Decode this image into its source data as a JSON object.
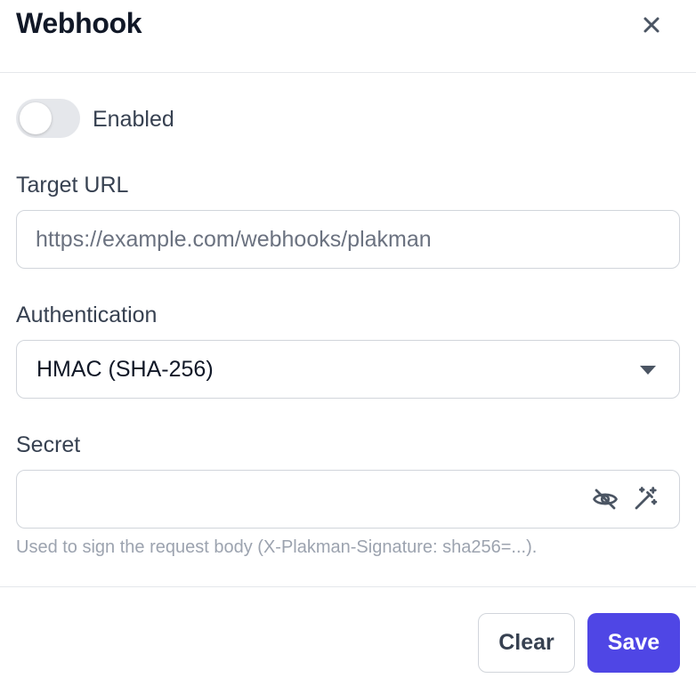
{
  "dialog": {
    "title": "Webhook"
  },
  "enabled": {
    "label": "Enabled",
    "value": false
  },
  "target_url": {
    "label": "Target URL",
    "placeholder": "https://example.com/webhooks/plakman",
    "value": ""
  },
  "authentication": {
    "label": "Authentication",
    "selected": "HMAC (SHA-256)"
  },
  "secret": {
    "label": "Secret",
    "value": "",
    "help": "Used to sign the request body (X-Plakman-Signature: sha256=...)."
  },
  "actions": {
    "clear_label": "Clear",
    "save_label": "Save"
  },
  "colors": {
    "primary": "#4f46e5",
    "toggle_off": "#e5e7eb",
    "border": "#d1d5db",
    "help_text": "#9ca3af"
  },
  "icons": {
    "close": "close-icon",
    "visibility": "eye-off-icon",
    "generate": "magic-wand-icon",
    "dropdown": "caret-down-icon"
  }
}
